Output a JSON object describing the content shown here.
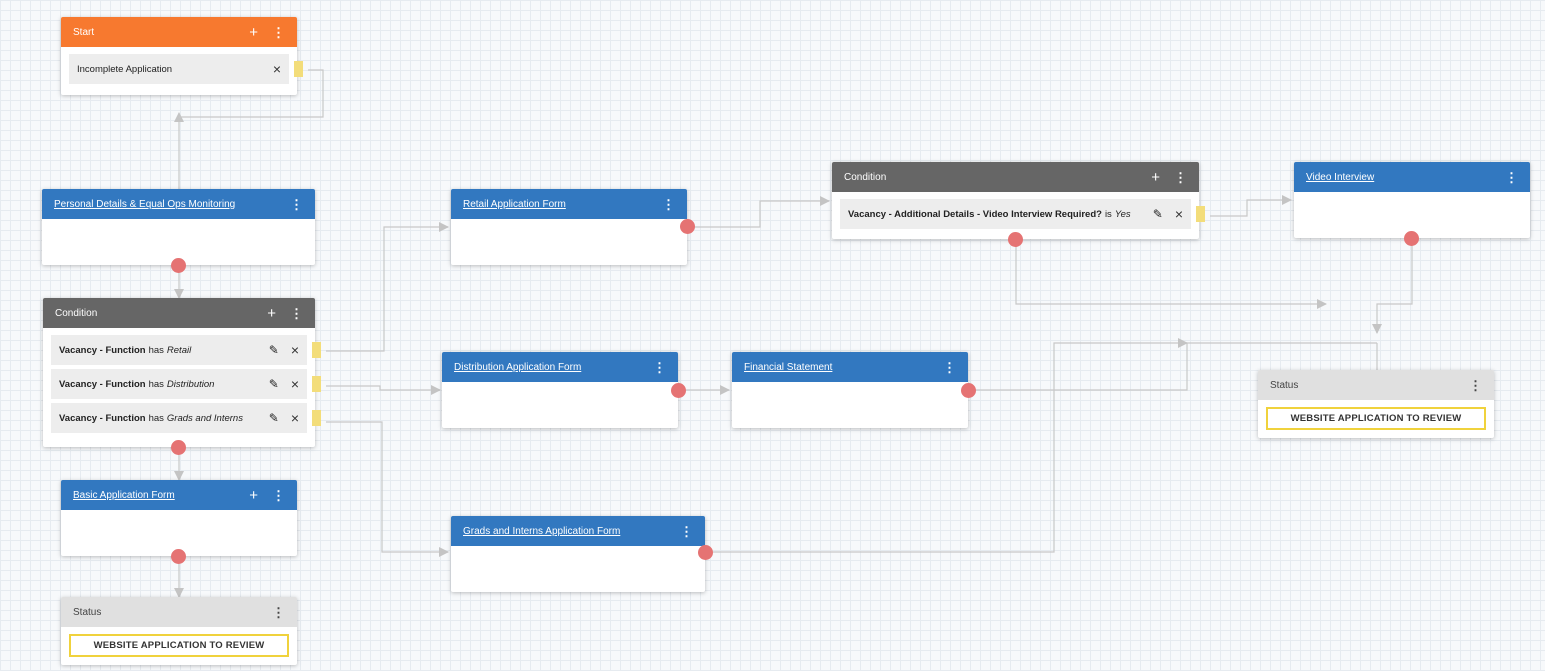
{
  "nodes": {
    "start": {
      "title": "Start",
      "item": "Incomplete Application"
    },
    "personal_details": {
      "title": "Personal Details & Equal Ops Monitoring"
    },
    "condition_left": {
      "title": "Condition",
      "rows": [
        {
          "field": "Vacancy - Function",
          "op": "has",
          "value": "Retail"
        },
        {
          "field": "Vacancy - Function",
          "op": "has",
          "value": "Distribution"
        },
        {
          "field": "Vacancy - Function",
          "op": "has",
          "value": "Grads and Interns"
        }
      ]
    },
    "basic_form": {
      "title": "Basic Application Form"
    },
    "status_left": {
      "title": "Status",
      "value": "WEBSITE APPLICATION TO REVIEW"
    },
    "retail_form": {
      "title": "Retail Application Form"
    },
    "distribution_form": {
      "title": "Distribution Application Form"
    },
    "grads_form": {
      "title": "Grads and Interns Application Form"
    },
    "financial_statement": {
      "title": "Financial Statement"
    },
    "condition_right": {
      "title": "Condition",
      "row": {
        "field": "Vacancy - Additional Details - Video Interview Required?",
        "op": "is",
        "value": "Yes"
      }
    },
    "video_interview": {
      "title": "Video Interview"
    },
    "status_right": {
      "title": "Status",
      "value": "WEBSITE APPLICATION TO REVIEW"
    }
  },
  "icons": {
    "add": "+",
    "menu": "⋮",
    "edit": "✎",
    "remove": "×"
  },
  "colors": {
    "start_header": "#f7792f",
    "form_header": "#3278c0",
    "condition_header": "#666666",
    "status_header": "#e0e0e0",
    "connector_dot": "#e57373",
    "status_border": "#f0d23c"
  }
}
